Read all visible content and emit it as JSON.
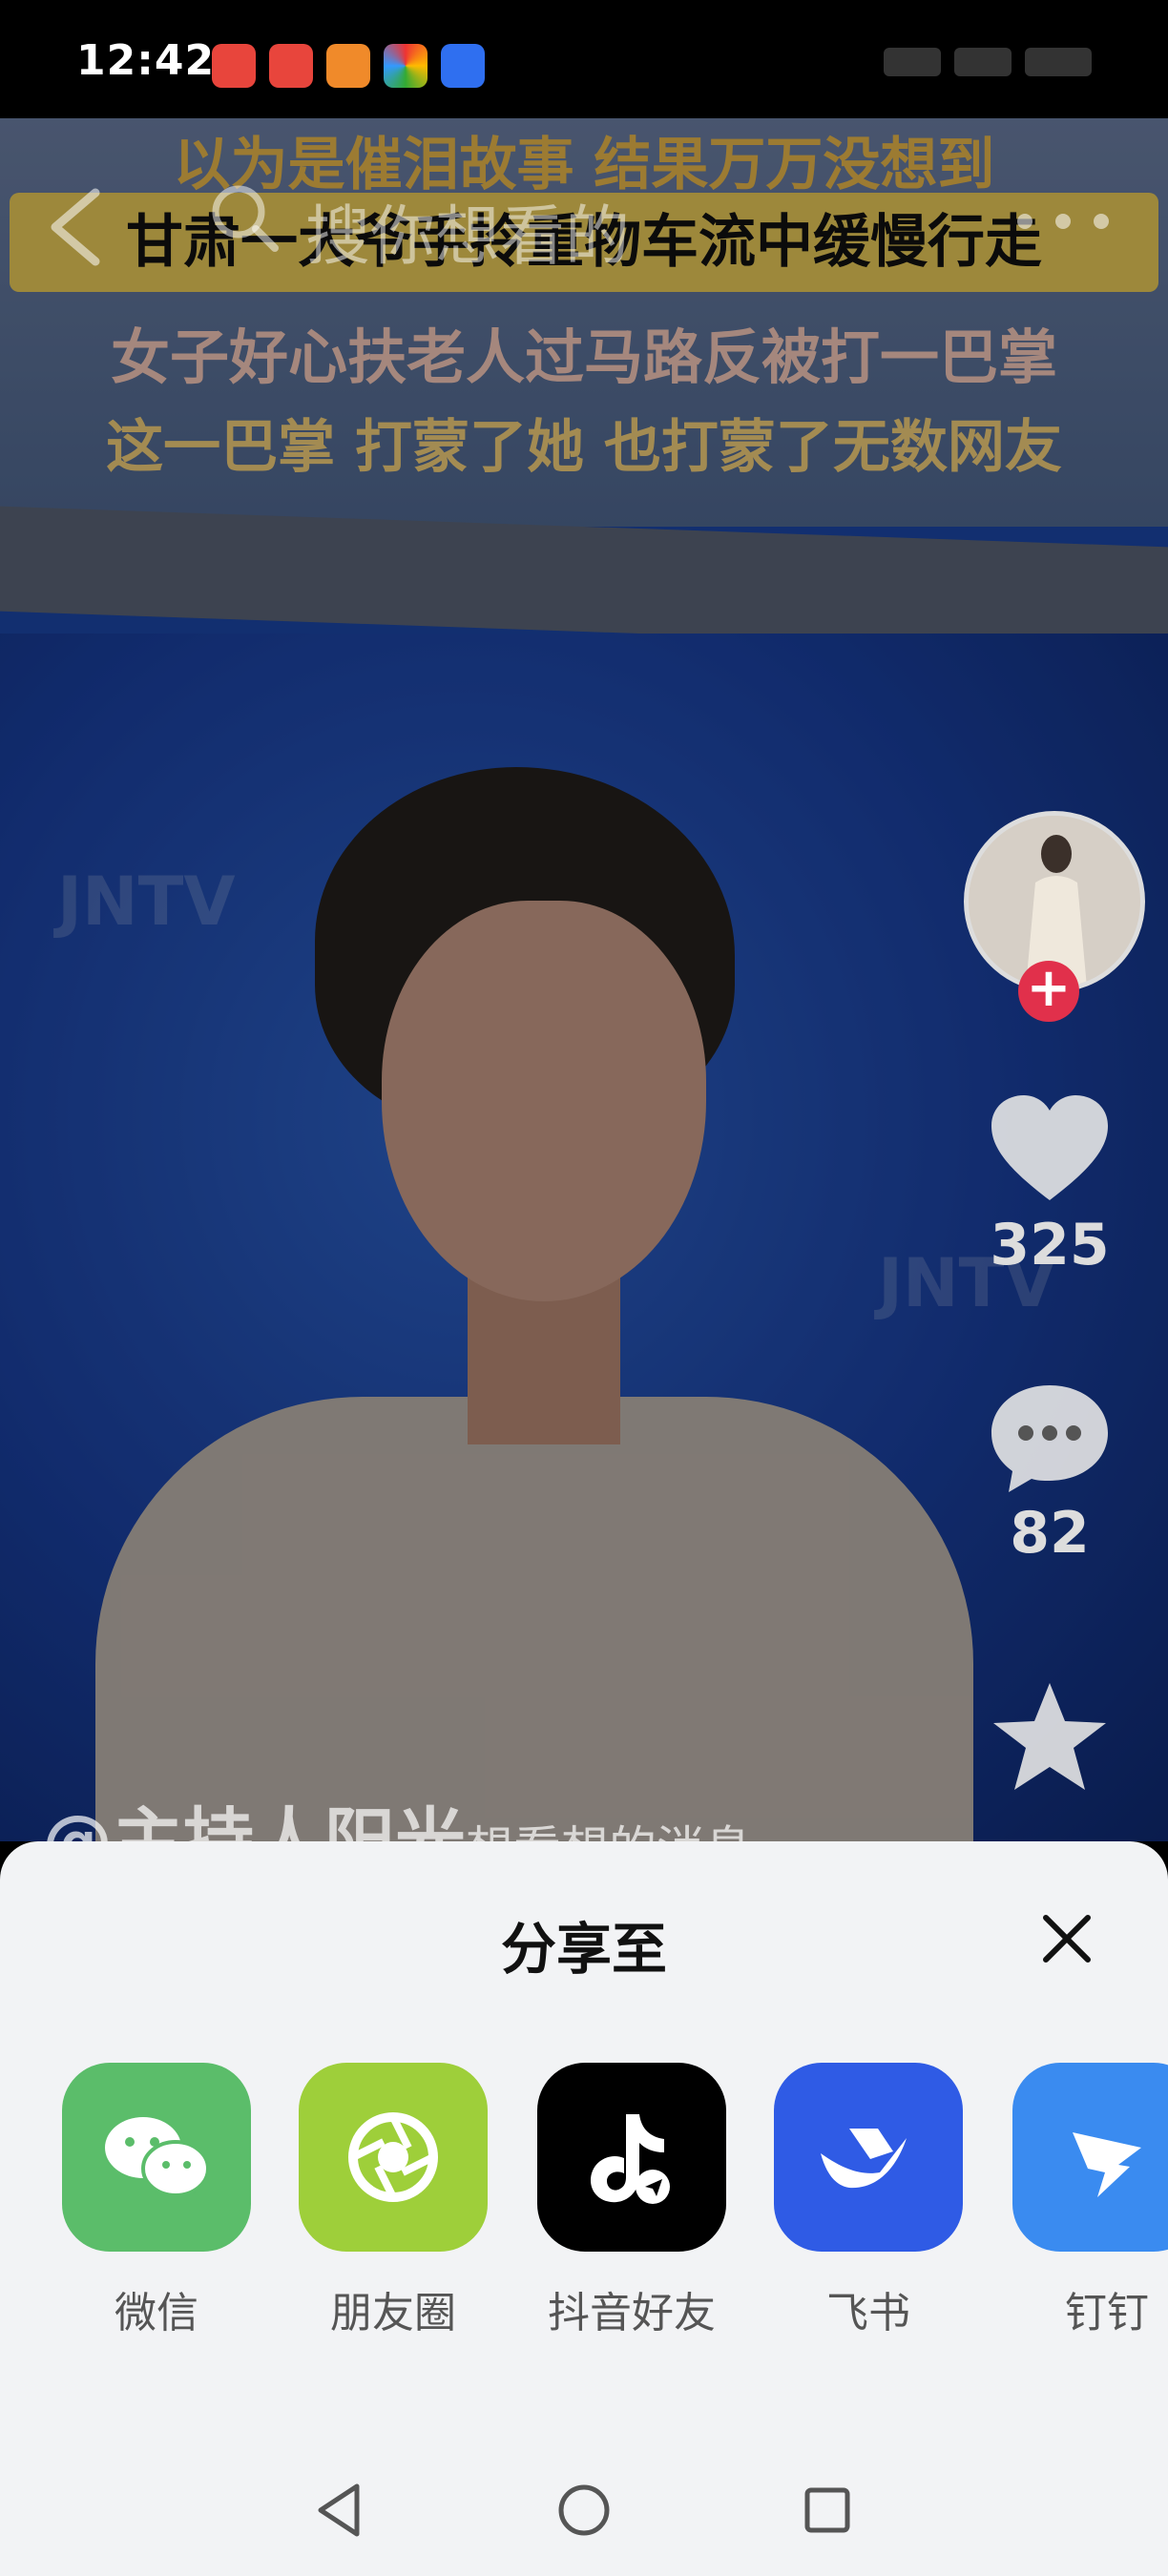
{
  "status_bar": {
    "time": "12:42",
    "app_icons": [
      "app-icon-red-1",
      "app-icon-red-2",
      "app-icon-orange-heart",
      "app-icon-colorful",
      "app-icon-blue"
    ]
  },
  "video": {
    "captions": [
      "以为是催泪故事  结果万万没想到",
      "甘肃一大爷手拎重物车流中缓慢行走",
      "女子好心扶老人过马路反被打一巴掌",
      "这一巴掌 打蒙了她 也打蒙了无数网友"
    ],
    "watermark": "JNTV",
    "author": "@主持人阳光",
    "author_subtext": "想看想的消息"
  },
  "top_bar": {
    "search_placeholder": "搜你想看的"
  },
  "rail": {
    "like_count": "325",
    "comment_count": "82"
  },
  "share_sheet": {
    "title": "分享至",
    "items": [
      {
        "label": "微信",
        "color": "#5bbd6a"
      },
      {
        "label": "朋友圈",
        "color": "#9ecf3a"
      },
      {
        "label": "抖音好友",
        "color": "#000000"
      },
      {
        "label": "飞书",
        "color": "#2f5be5"
      },
      {
        "label": "钉钉",
        "color": "#3a8bf0"
      }
    ]
  },
  "nav_bar": {
    "buttons": [
      "back-triangle",
      "home-circle",
      "recents-square"
    ]
  }
}
